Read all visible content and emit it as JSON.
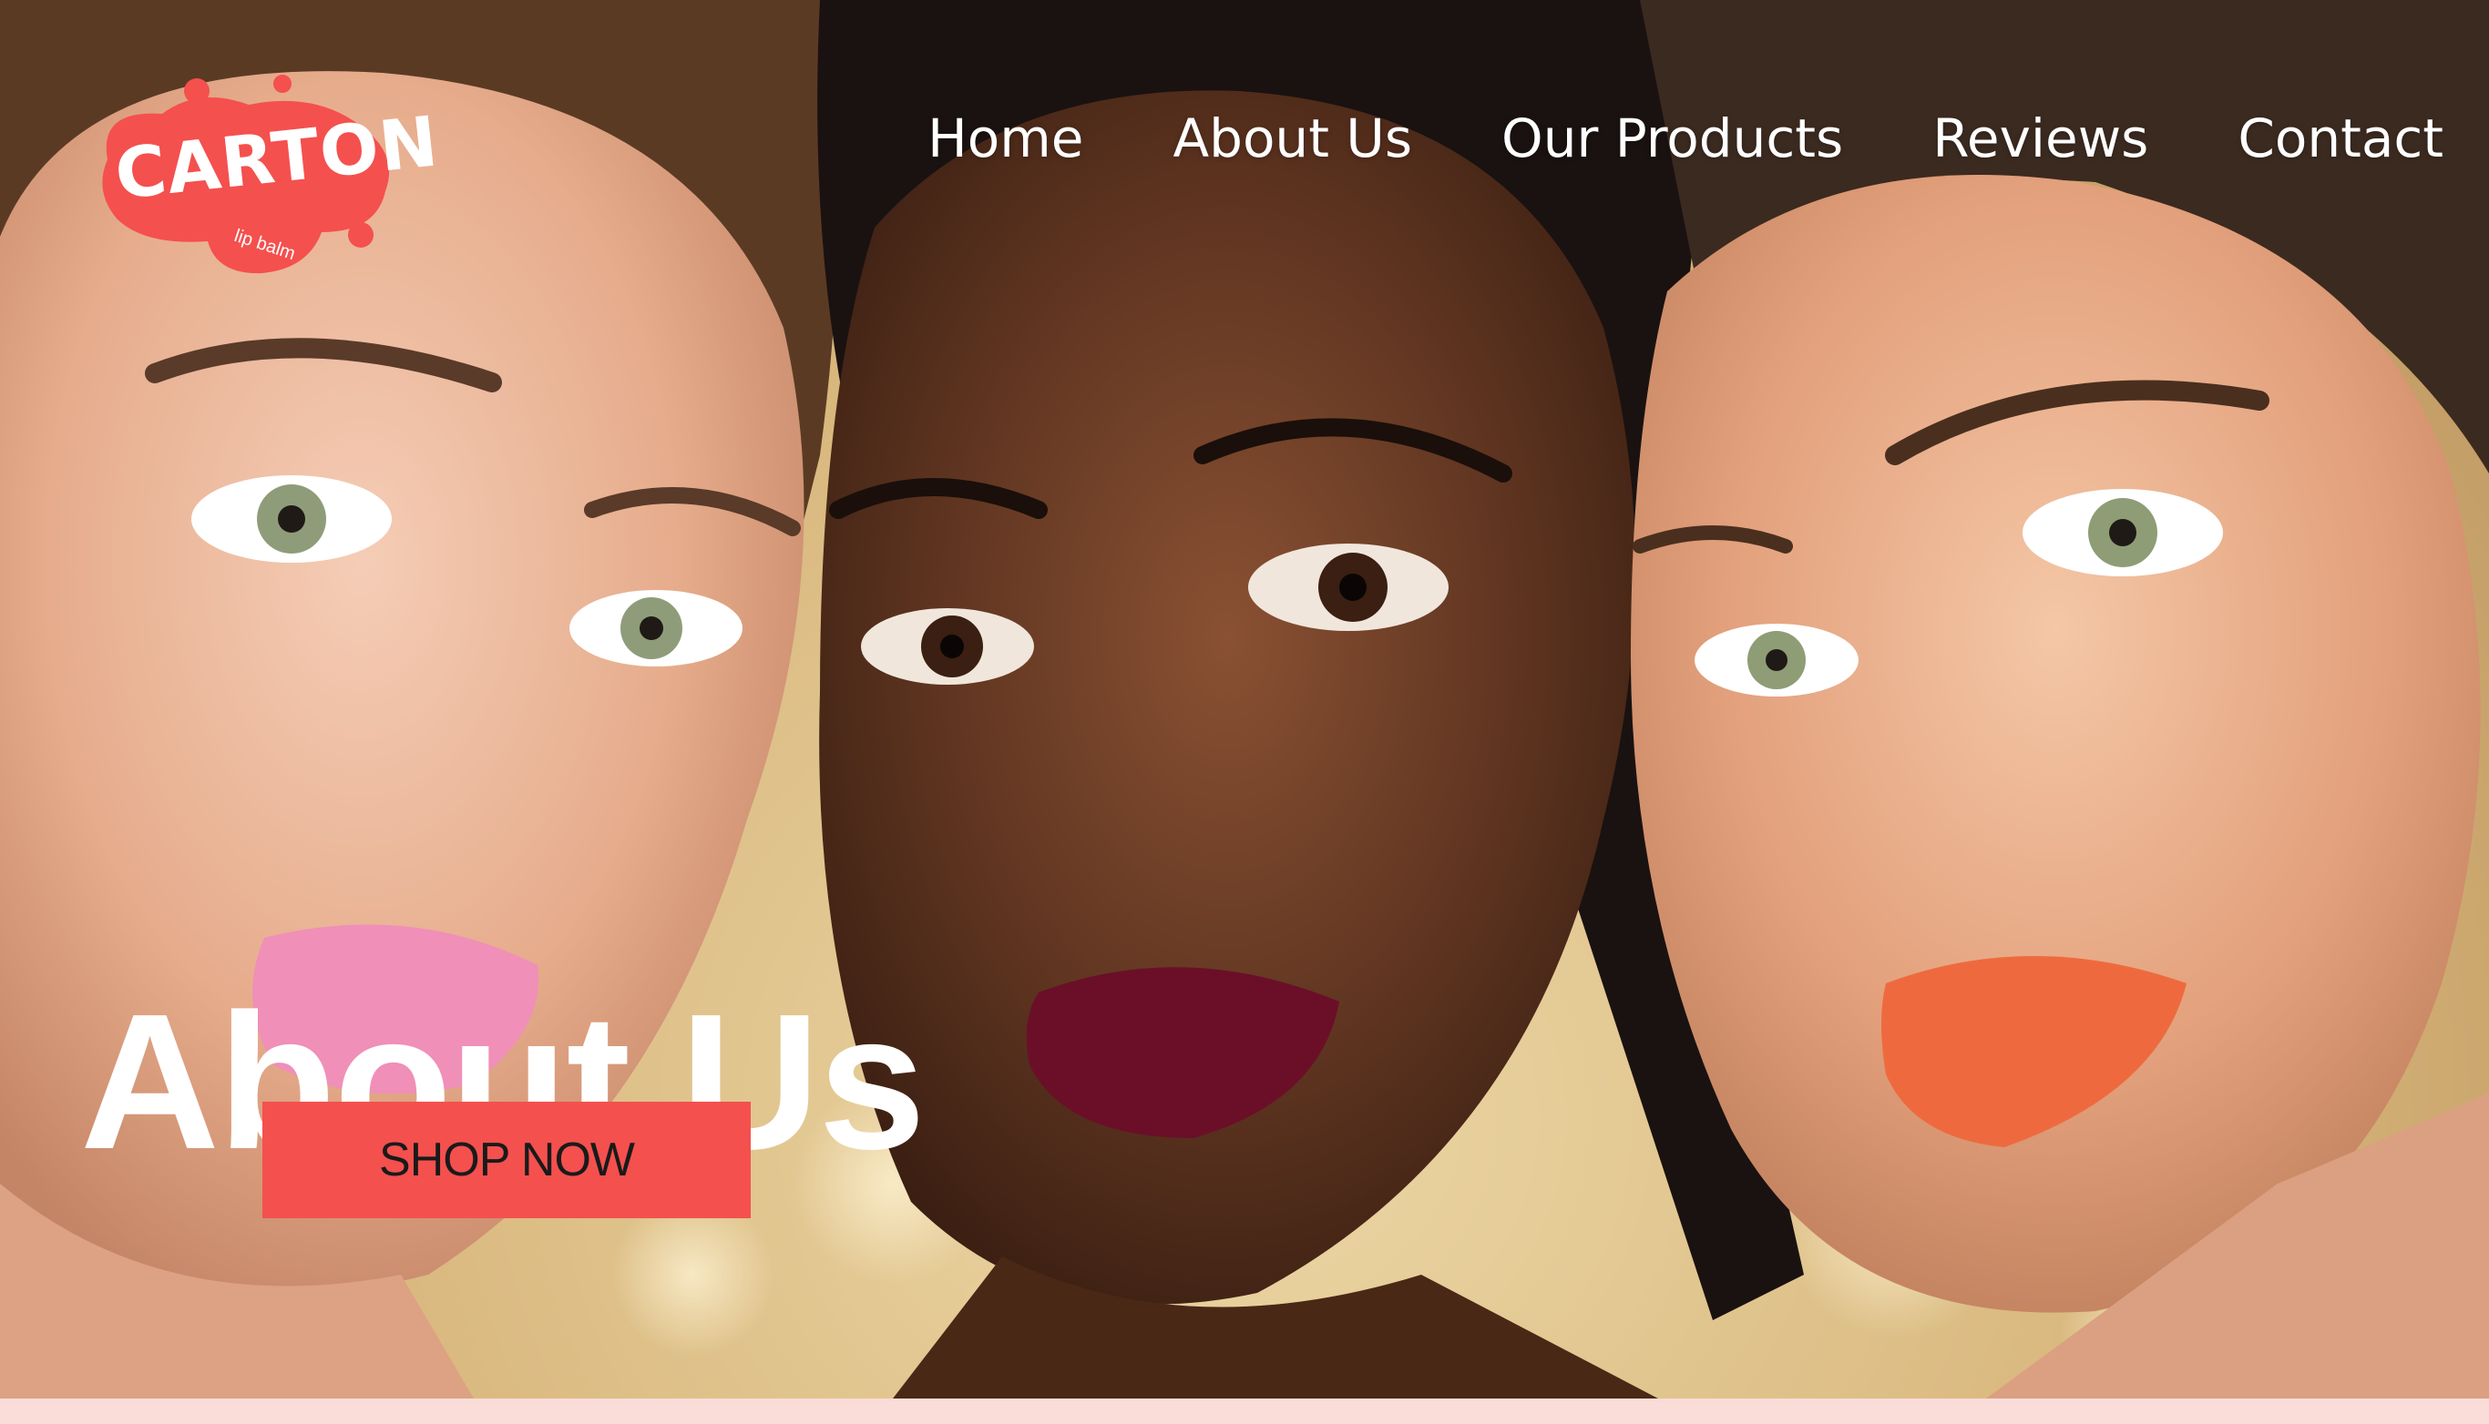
{
  "brand": {
    "logo_text": "CARTON",
    "logo_subtext": "lip balm",
    "logo_color": "#f4504e"
  },
  "nav": {
    "items": [
      {
        "label": "Home"
      },
      {
        "label": "About Us"
      },
      {
        "label": "Our Products"
      },
      {
        "label": "Reviews"
      },
      {
        "label": "Contact"
      }
    ]
  },
  "hero": {
    "title": "About Us",
    "cta_label": "SHOP NOW",
    "cta_color": "#f4504e",
    "image_icon": "portrait-photo-three-models"
  },
  "footer_strip_color": "#fadcd8"
}
